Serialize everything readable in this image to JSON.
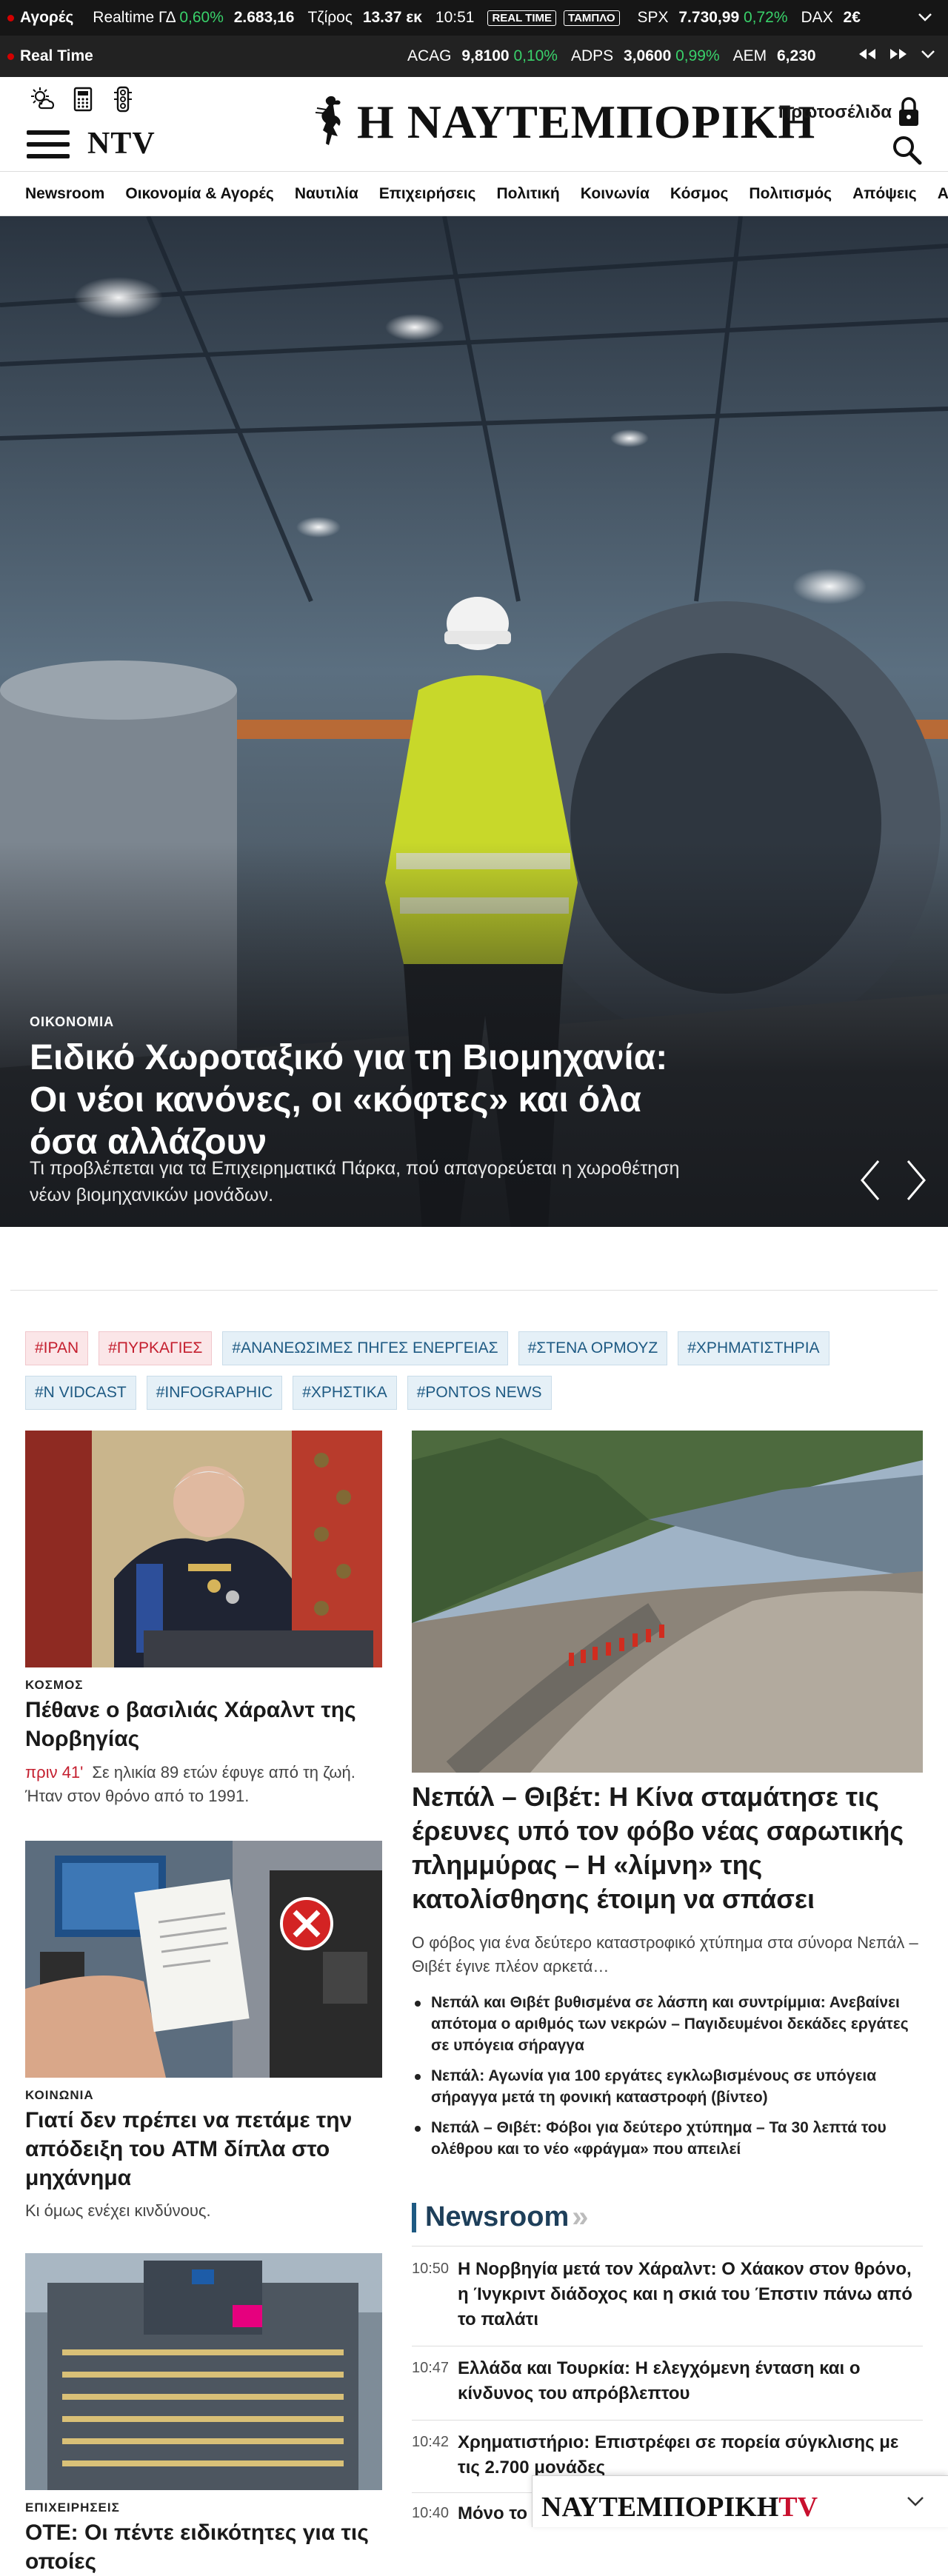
{
  "ticker1": {
    "label": "Αγορές",
    "items": [
      {
        "name": "Realtime ΓΔ",
        "change": "0,60%",
        "value": "2.683,16"
      },
      {
        "name": "Τζίρος",
        "value": "13.37 εκ"
      },
      {
        "name": "10:51"
      }
    ],
    "badges": [
      "REAL TIME",
      "ΤΑΜΠΛΟ"
    ],
    "indices": [
      {
        "name": "SPX",
        "value": "7.730,99",
        "change": "0,72%"
      },
      {
        "name": "DAX",
        "value": "2€"
      }
    ],
    "dropdown_icon": "chevron-down-icon"
  },
  "ticker2": {
    "label": "Real Time",
    "stocks": [
      {
        "name": "ACAG",
        "value": "9,8100",
        "change": "0,10%"
      },
      {
        "name": "ADPS",
        "value": "3,0600",
        "change": "0,99%"
      },
      {
        "name": "AEM",
        "value": "6,230"
      }
    ],
    "controls": [
      "rewind-icon",
      "fast-forward-icon",
      "chevron-down-icon"
    ]
  },
  "header": {
    "logo_text": "Η ΝΑΥΤΕΜΠΟΡΙΚΗ",
    "ntv_label": "NTV",
    "front_pages": "Πρωτοσέλιδα",
    "icons": [
      "weather-icon",
      "calculator-icon",
      "traffic-light-icon",
      "menu-icon",
      "lock-icon",
      "search-icon"
    ]
  },
  "nav": [
    "Newsroom",
    "Οικονομία & Αγορές",
    "Ναυτιλία",
    "Επιχειρήσεις",
    "Πολιτική",
    "Κοινωνία",
    "Κόσμος",
    "Πολιτισμός",
    "Απόψεις",
    "Αθλη"
  ],
  "hero": {
    "category": "ΟΙΚΟΝΟΜΙΑ",
    "title": "Ειδικό Χωροταξικό για τη Βιομηχανία: Οι νέοι κανόνες, οι «κόφτες» και όλα όσα αλλάζουν",
    "subtitle": "Τι προβλέπεται για τα Επιχειρηματικά Πάρκα, πού απαγορεύεται η χωροθέτηση νέων βιομηχανικών μονάδων."
  },
  "tags": [
    {
      "label": "#ΙΡΑΝ",
      "style": "red"
    },
    {
      "label": "#ΠΥΡΚΑΓΙΕΣ",
      "style": "red"
    },
    {
      "label": "#ΑΝΑΝΕΩΣΙΜΕΣ ΠΗΓΕΣ ΕΝΕΡΓΕΙΑΣ",
      "style": "blue"
    },
    {
      "label": "#ΣΤΕΝΑ ΟΡΜΟΥΖ",
      "style": "blue"
    },
    {
      "label": "#ΧΡΗΜΑΤΙΣΤΗΡΙΑ",
      "style": "blue"
    },
    {
      "label": "#N VIDCAST",
      "style": "blue"
    },
    {
      "label": "#INFOGRAPHIC",
      "style": "blue"
    },
    {
      "label": "#ΧΡΗΣΤΙΚΑ",
      "style": "blue"
    },
    {
      "label": "#PONTOS NEWS",
      "style": "blue"
    }
  ],
  "articles": {
    "a1": {
      "category": "ΚΟΣΜΟΣ",
      "title": "Πέθανε ο βασιλιάς Χάραλντ της Νορβηγίας",
      "time": "πριν 41'",
      "desc": "Σε ηλικία 89 ετών έφυγε από τη ζωή. Ήταν στον θρόνο από το 1991."
    },
    "a2": {
      "category": "ΚΟΙΝΩΝΙΑ",
      "title": "Γιατί δεν πρέπει να πετάμε την απόδειξη του ATM δίπλα στο μηχάνημα",
      "desc": "Κι όμως ενέχει κινδύνους."
    },
    "a3": {
      "category": "ΕΠΙΧΕΙΡΗΣΕΙΣ",
      "title": "ΟΤΕ: Οι πέντε ειδικότητες για τις οποίες"
    },
    "main": {
      "title": "Νεπάλ – Θιβέτ: Η Κίνα σταμάτησε τις έρευνες υπό τον φόβο νέας σαρωτικής πλημμύρας – Η «λίμνη» της κατολίσθησης έτοιμη να σπάσει",
      "desc": "Ο φόβος για ένα δεύτερο καταστροφικό χτύπημα στα σύνορα Νεπάλ – Θιβέτ έγινε πλέον αρκετά…",
      "related": [
        "Νεπάλ και Θιβέτ βυθισμένα σε λάσπη και συντρίμμια: Ανεβαίνει απότομα ο αριθμός των νεκρών – Παγιδευμένοι δεκάδες εργάτες σε υπόγεια σήραγγα",
        "Νεπάλ: Αγωνία για 100 εργάτες εγκλωβισμένους σε υπόγεια σήραγγα μετά τη φονική καταστροφή (βίντεο)",
        "Νεπάλ – Θιβέτ: Φόβοι για δεύτερο χτύπημα – Τα 30 λεπτά του ολέθρου και το νέο «φράγμα» που απειλεί"
      ]
    }
  },
  "newsroom": {
    "title": "Newsroom",
    "items": [
      {
        "time": "10:50",
        "text": "Η Νορβηγία μετά τον Χάραλντ: Ο Χάακον στον θρόνο, η Ίνγκριντ διάδοχος και η σκιά του Έπστιν πάνω από το παλάτι"
      },
      {
        "time": "10:47",
        "text": "Ελλάδα και Τουρκία: Η ελεγχόμενη ένταση και ο κίνδυνος του απρόβλεπτου"
      },
      {
        "time": "10:42",
        "text": "Χρηματιστήριο: Επιστρέφει σε πορεία σύγκλισης με τις 2.700 μονάδες"
      },
      {
        "time": "10:40",
        "text": "Μόνο το"
      }
    ]
  },
  "ntv_player": {
    "logo": "ΝΑΥΤΕΜΠΟΡΙΚΗ",
    "suffix": "TV"
  },
  "colors": {
    "accent_red": "#c41e2e",
    "accent_blue": "#1e5a83",
    "up_green": "#39d16a"
  }
}
